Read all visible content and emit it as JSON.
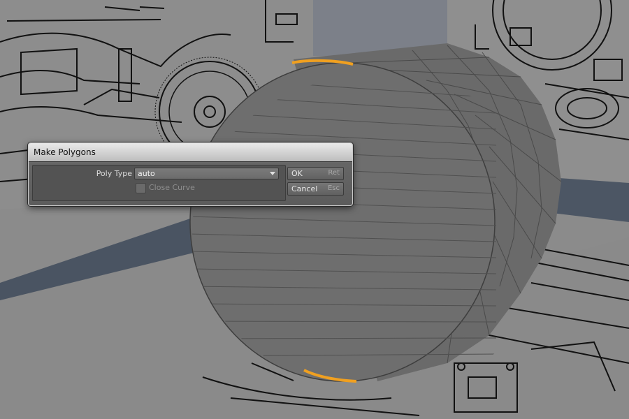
{
  "dialog": {
    "title": "Make Polygons",
    "poly_type_label": "Poly Type",
    "poly_type_value": "auto",
    "close_curve_label": "Close Curve",
    "close_curve_checked": false,
    "ok_label": "OK",
    "ok_shortcut": "Ret",
    "cancel_label": "Cancel",
    "cancel_shortcut": "Esc"
  },
  "colors": {
    "viewport_background": "#8a8a8a",
    "mesh_surface": "#6e6e6e",
    "selection_highlight": "#f0a020",
    "blueprint_lines": "#111111"
  },
  "icons": [
    "chevron-down-icon",
    "checkbox-icon"
  ]
}
